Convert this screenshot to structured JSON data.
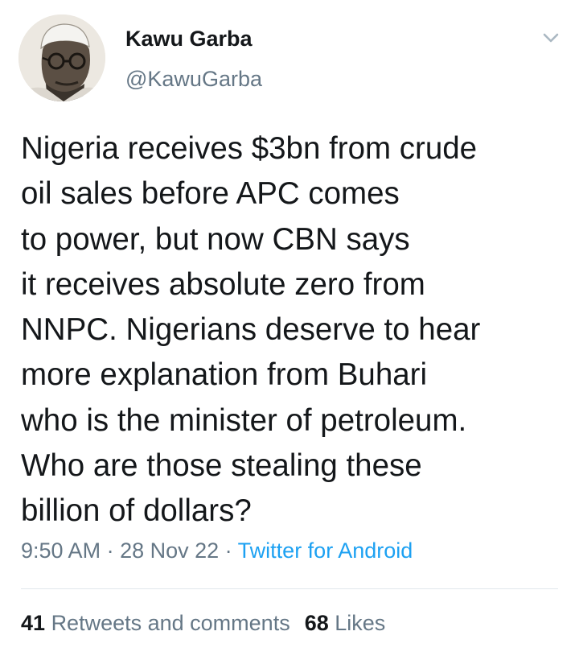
{
  "author": {
    "display_name": "Kawu Garba",
    "handle": "@KawuGarba"
  },
  "tweet": {
    "lines": [
      "Nigeria receives $3bn from crude",
      "oil sales before APC comes",
      "to power, but now CBN says",
      "it receives absolute zero from",
      "NNPC. Nigerians deserve to hear",
      "more explanation from Buhari",
      "who is the minister of petroleum.",
      "Who are those stealing these",
      "billion of dollars?"
    ],
    "time": "9:50 AM",
    "separator": " · ",
    "date": "28 Nov 22",
    "source": "Twitter for Android"
  },
  "stats": {
    "retweets_count": "41",
    "retweets_label": "Retweets and comments",
    "likes_count": "68",
    "likes_label": "Likes"
  },
  "icons": {
    "menu": "chevron-down-icon"
  },
  "colors": {
    "text": "#14171a",
    "secondary": "#657786",
    "link": "#1da1f2",
    "divider": "#e1e8ed"
  }
}
